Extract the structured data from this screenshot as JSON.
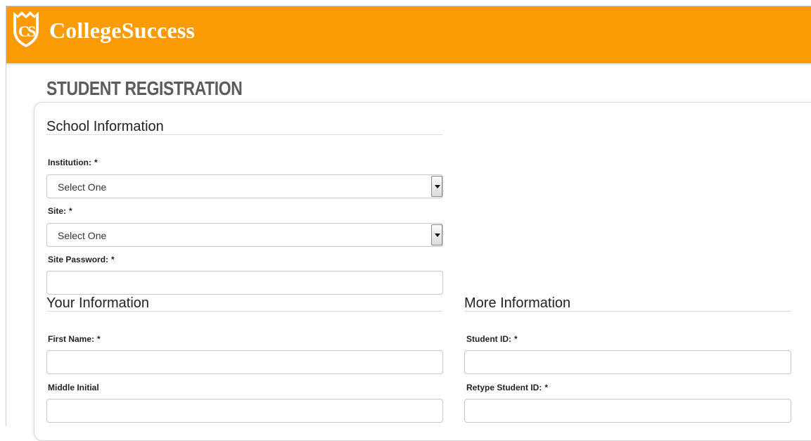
{
  "brand": {
    "name": "CollegeSuccess",
    "logo_letters": "CS"
  },
  "colors": {
    "header_bg": "#fb9b05",
    "title_color": "#5c5c5c"
  },
  "page": {
    "title": "STUDENT REGISTRATION"
  },
  "school_info": {
    "title": "School Information",
    "institution": {
      "label": "Institution:",
      "required": "*",
      "value": "Select One"
    },
    "site": {
      "label": "Site:",
      "required": "*",
      "value": "Select One"
    },
    "site_password": {
      "label": "Site Password:",
      "required": "*",
      "value": ""
    }
  },
  "your_info": {
    "title": "Your Information",
    "first_name": {
      "label": "First Name:",
      "required": "*",
      "value": ""
    },
    "middle_initial": {
      "label": "Middle Initial",
      "value": ""
    }
  },
  "more_info": {
    "title": "More Information",
    "student_id": {
      "label": "Student ID:",
      "required": "*",
      "value": ""
    },
    "retype_student_id": {
      "label": "Retype Student ID:",
      "required": "*",
      "value": ""
    }
  }
}
